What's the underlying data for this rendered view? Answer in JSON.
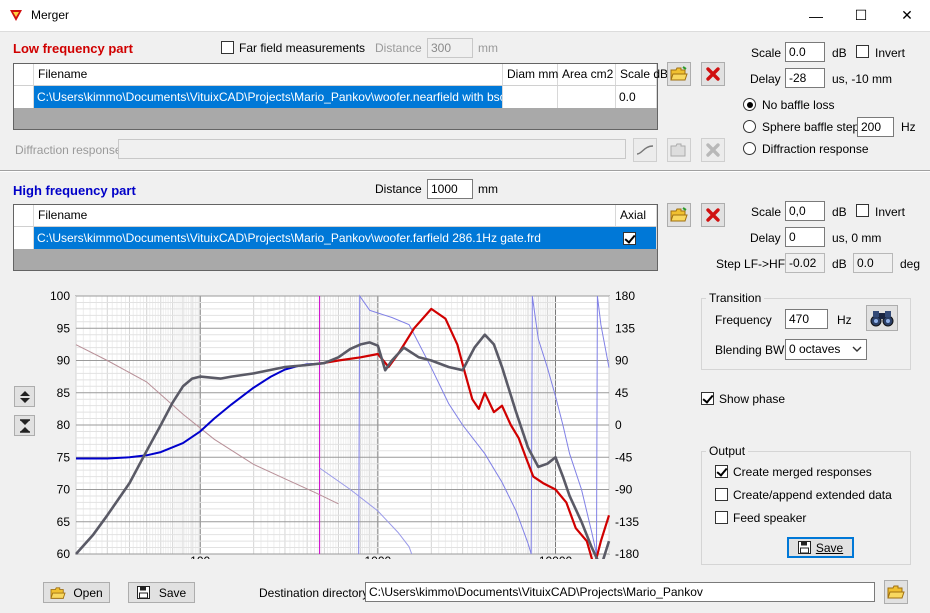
{
  "window": {
    "title": "Merger",
    "min": "—",
    "max": "☐",
    "close": "✕"
  },
  "lf": {
    "header": "Low frequency part",
    "far_field_label": "Far field measurements",
    "distance_label": "Distance",
    "distance_value": "300",
    "distance_unit": "mm",
    "columns": [
      "Filename",
      "Diam mm",
      "Area cm2",
      "Scale dB"
    ],
    "row": {
      "filename": "C:\\Users\\kimmo\\Documents\\VituixCAD\\Projects\\Mario_Pankov\\woofer.nearfield with bsc.frd",
      "diam": "",
      "area": "",
      "scale": "0.0"
    },
    "diffraction_label": "Diffraction response",
    "scale_label": "Scale",
    "scale_value": "0.0",
    "scale_unit": "dB",
    "invert_label": "Invert",
    "delay_label": "Delay",
    "delay_value": "-28",
    "delay_unit": "us, -10 mm",
    "baffle_options": [
      "No baffle loss",
      "Sphere baffle step",
      "Diffraction response"
    ],
    "sphere_value": "200",
    "sphere_unit": "Hz"
  },
  "hf": {
    "header": "High frequency part",
    "distance_label": "Distance",
    "distance_value": "1000",
    "distance_unit": "mm",
    "columns": [
      "Filename",
      "Axial"
    ],
    "row": {
      "filename": "C:\\Users\\kimmo\\Documents\\VituixCAD\\Projects\\Mario_Pankov\\woofer.farfield 286.1Hz gate.frd",
      "axial": true
    },
    "scale_label": "Scale",
    "scale_value": "0,0",
    "scale_unit": "dB",
    "invert_label": "Invert",
    "delay_label": "Delay",
    "delay_value": "0",
    "delay_unit": "us,  0 mm",
    "step_label": "Step LF->HF",
    "step_db": "-0.02",
    "step_db_unit": "dB",
    "step_deg": "0.0",
    "step_deg_unit": "deg"
  },
  "transition": {
    "group_label": "Transition",
    "frequency_label": "Frequency",
    "frequency_value": "470",
    "frequency_unit": "Hz",
    "blending_label": "Blending BW",
    "blending_value": "0 octaves"
  },
  "show_phase_label": "Show phase",
  "output": {
    "group_label": "Output",
    "options": [
      "Create merged responses",
      "Create/append extended data",
      "Feed speaker"
    ],
    "save_label": "Save"
  },
  "bottom": {
    "open_label": "Open",
    "save_label": "Save",
    "dest_label": "Destination directory",
    "dest_value": "C:\\Users\\kimmo\\Documents\\VituixCAD\\Projects\\Mario_Pankov"
  },
  "colors": {
    "lf_header": "#d00000",
    "hf_header": "#0000c8",
    "selection": "#0078d7",
    "merged": "#555566",
    "hf_curve": "#e00000",
    "lf_curve": "#0000cc",
    "transition_marker": "#cc00cc"
  },
  "chart_data": {
    "type": "line",
    "x_scale": "log",
    "xlim": [
      20,
      20000
    ],
    "ylim": [
      60,
      100
    ],
    "y2lim": [
      -180,
      180
    ],
    "x_ticks": [
      "100",
      "1000",
      "10000"
    ],
    "y_ticks": [
      "100",
      "95",
      "90",
      "85",
      "80",
      "75",
      "70",
      "65",
      "60"
    ],
    "y2_ticks": [
      "180",
      "135",
      "90",
      "45",
      "0",
      "-45",
      "-90",
      "-135",
      "-180"
    ],
    "grid": true,
    "transition_marker_hz": 470,
    "series": [
      {
        "color": "#d00000",
        "x": [
          470,
          600,
          800,
          1000,
          1150,
          1300,
          1600,
          2000,
          2400,
          2800,
          3100,
          3400,
          3700,
          4000,
          4500,
          5000,
          5600,
          6200,
          6800,
          7500,
          8500,
          10000,
          11500,
          13000,
          15000,
          16500,
          18000,
          20000
        ],
        "y": [
          89.5,
          90,
          90.5,
          91,
          89,
          91,
          95,
          98,
          96.5,
          92.5,
          88,
          84,
          82.5,
          85,
          82,
          83,
          80,
          78,
          75,
          72,
          71,
          70,
          68,
          64,
          62,
          58,
          62,
          66
        ]
      },
      {
        "color": "#0000cc",
        "x": [
          20,
          30,
          40,
          50,
          60,
          80,
          100,
          120,
          150,
          200,
          250,
          300,
          350,
          400,
          470
        ],
        "y": [
          74.8,
          74.8,
          75,
          75.3,
          75.8,
          77.2,
          79,
          81,
          83.2,
          85.8,
          87.5,
          88.6,
          89.1,
          89.4,
          89.5
        ]
      },
      {
        "color": "#5a5a66",
        "x": [
          20,
          25,
          30,
          40,
          50,
          60,
          70,
          80,
          90,
          100,
          130,
          150,
          200,
          300,
          400,
          500,
          600,
          700,
          800,
          900,
          1000,
          1100,
          1200,
          1400,
          1700,
          2000,
          2500,
          3000,
          3500,
          4000,
          4500,
          5000,
          6000,
          7000,
          8000,
          9000,
          10000,
          11000,
          12000,
          14000,
          16000,
          18000,
          20000
        ],
        "y": [
          60,
          63,
          66,
          71,
          76,
          80,
          83.5,
          86,
          87.2,
          87.5,
          87.2,
          87.5,
          88,
          89,
          89.3,
          89.6,
          90.5,
          91.8,
          92.5,
          92.8,
          92.3,
          88.5,
          90,
          92,
          90.5,
          90,
          89,
          88.5,
          92,
          94,
          92.5,
          89,
          82,
          76.5,
          73.5,
          74,
          75,
          72,
          69,
          65,
          61,
          58,
          62
        ]
      }
    ]
  }
}
